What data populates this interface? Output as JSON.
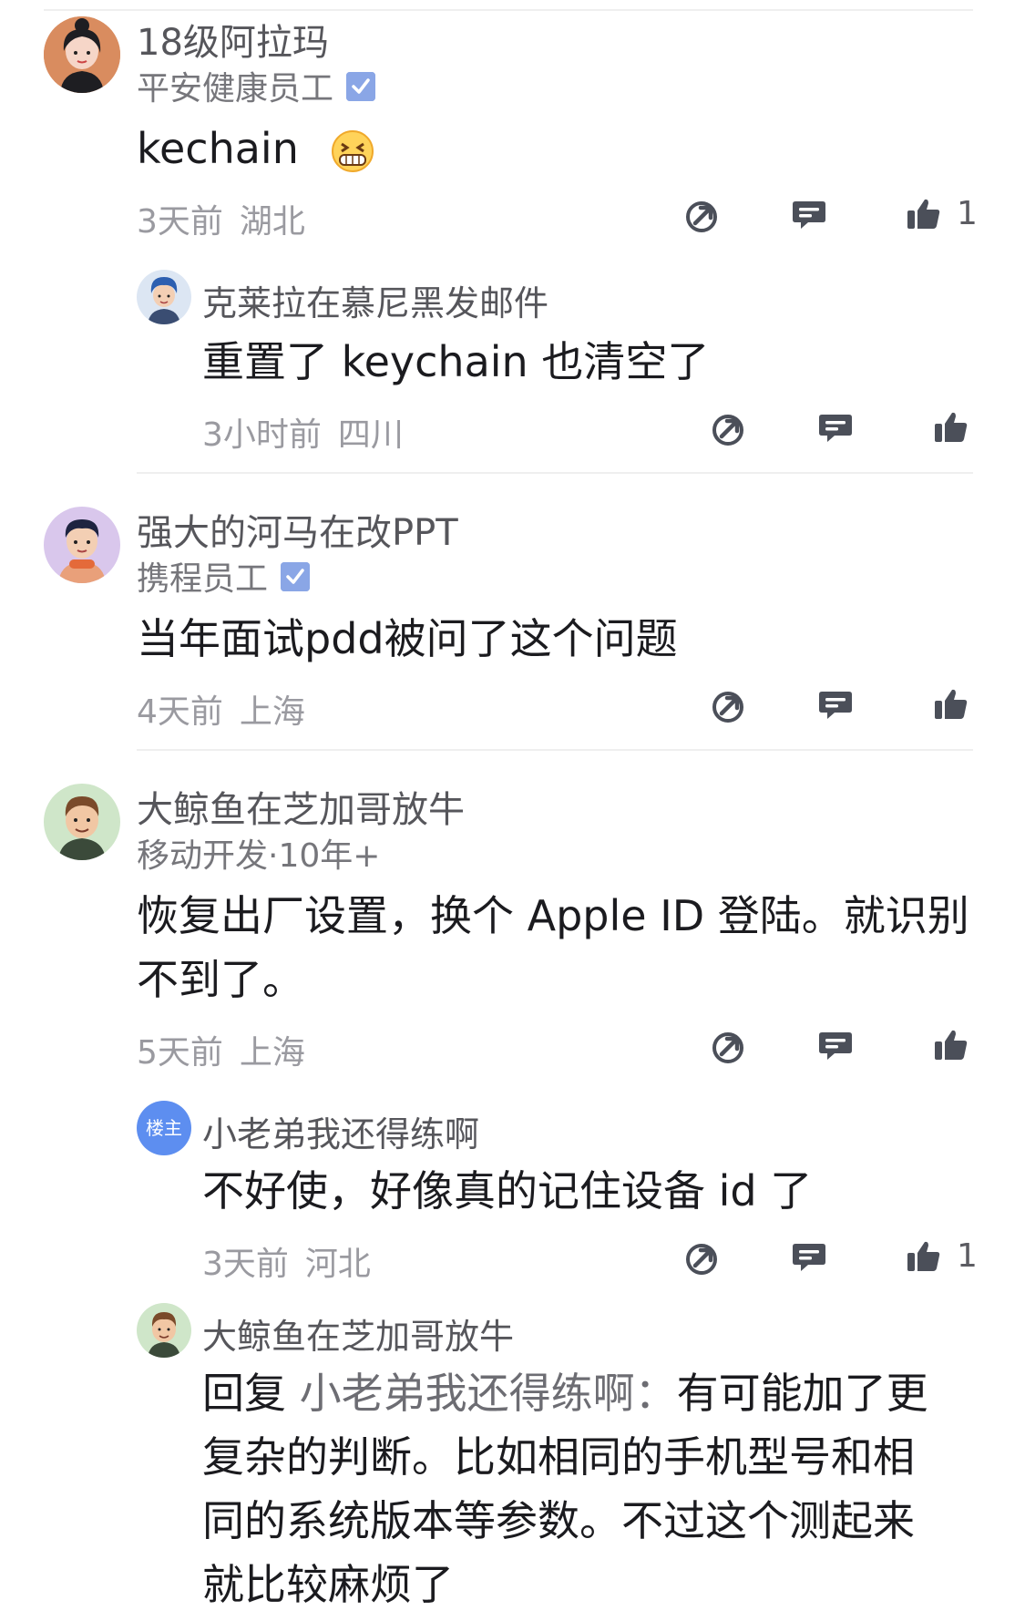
{
  "comments": [
    {
      "author": "18级阿拉玛",
      "subtitle": "平安健康员工",
      "content": "kechain",
      "emoji": "😁",
      "time": "3天前",
      "location": "湖北",
      "likes": "1",
      "replies": [
        {
          "author": "克莱拉在慕尼黑发邮件",
          "content": "重置了 keychain 也清空了",
          "time": "3小时前",
          "location": "四川"
        }
      ]
    },
    {
      "author": "强大的河马在改PPT",
      "subtitle": "携程员工",
      "content": "当年面试pdd被问了这个问题",
      "time": "4天前",
      "location": "上海"
    },
    {
      "author": "大鲸鱼在芝加哥放牛",
      "subtitle": "移动开发·10年+",
      "content_lines": [
        "恢复出厂设置，换个 Apple ID 登陆。就识别",
        "不到了。"
      ],
      "time": "5天前",
      "location": "上海",
      "replies": [
        {
          "badge": "楼主",
          "author": "小老弟我还得练啊",
          "content": "不好使，好像真的记住设备 id 了",
          "time": "3天前",
          "location": "河北",
          "likes": "1"
        },
        {
          "author": "大鲸鱼在芝加哥放牛",
          "reply_prefix": "回复",
          "reply_target": "小老弟我还得练啊",
          "reply_colon": "：",
          "content_lines": [
            "有可能加了更",
            "复杂的判断。比如相同的手机型号和相",
            "同的系统版本等参数。不过这个测起来",
            "就比较麻烦了"
          ]
        }
      ]
    }
  ],
  "icons": {
    "share": "share-icon",
    "comment": "comment-icon",
    "like": "thumbs-up-icon",
    "verified": "verified-icon"
  },
  "colors": {
    "text": "#1b1b1f",
    "name": "#56565b",
    "meta": "#9a9aa0",
    "icon": "#4b4f59",
    "verified": "#8aa6e6",
    "op_badge": "#5d8ef0"
  }
}
